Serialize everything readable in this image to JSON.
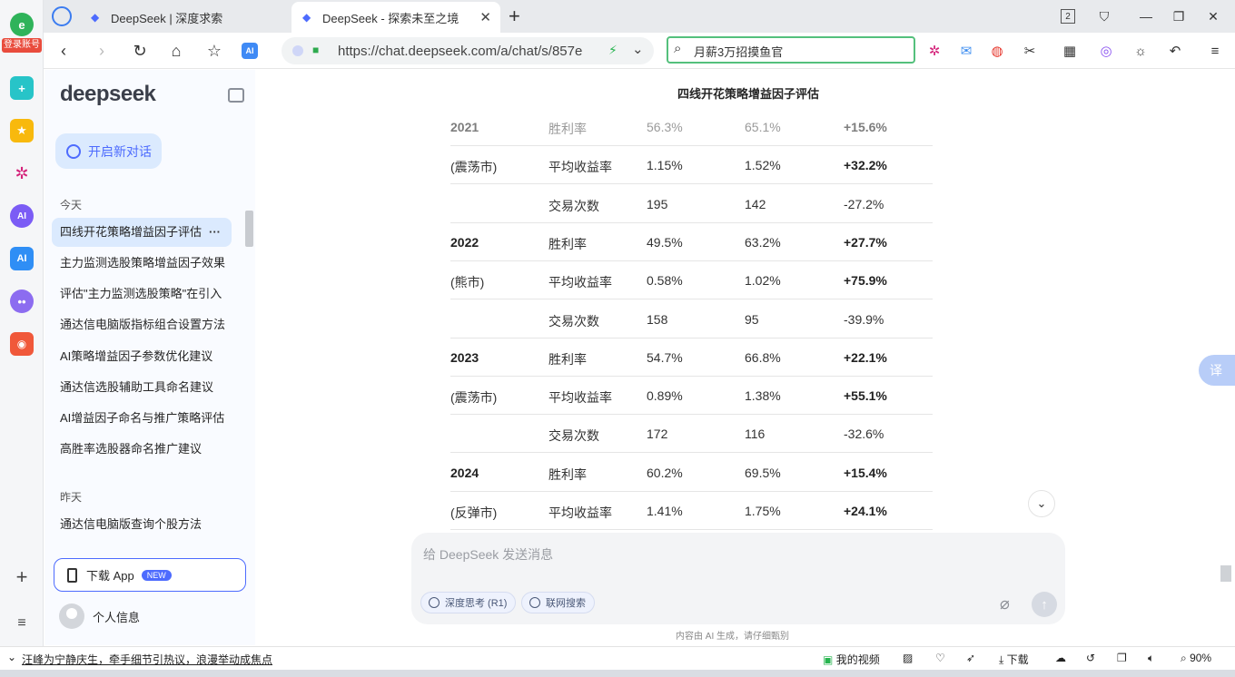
{
  "left_strip": {
    "login_label": "登录账号",
    "icons": [
      "browser-logo-icon",
      "plus-app-icon",
      "star-favorites-icon",
      "network-app-icon",
      "ai-assistant-icon",
      "ai-app-icon",
      "bot-icon",
      "game-icon",
      "add-icon",
      "menu-list-icon"
    ]
  },
  "tabs": [
    {
      "title": "DeepSeek | 深度求索",
      "active": false
    },
    {
      "title": "DeepSeek - 探索未至之境",
      "active": true
    }
  ],
  "tab_count": "2",
  "url": "https://chat.deepseek.com/a/chat/s/857e",
  "search_query": "月薪3万招摸鱼官",
  "sidebar": {
    "logo": "deepseek",
    "new_chat": "开启新对话",
    "today_label": "今天",
    "today_items": [
      "四线开花策略增益因子评估",
      "主力监测选股策略增益因子效果",
      "评估\"主力监测选股策略\"在引入",
      "通达信电脑版指标组合设置方法",
      "AI策略增益因子参数优化建议",
      "通达信选股辅助工具命名建议",
      "AI增益因子命名与推广策略评估",
      "高胜率选股器命名推广建议"
    ],
    "more_label": "···",
    "yesterday_label": "昨天",
    "yesterday_items": [
      "通达信电脑版查询个股方法"
    ],
    "download_app": "下载 App",
    "new_badge": "NEW",
    "profile": "个人信息"
  },
  "table": {
    "title": "四线开花策略增益因子评估",
    "rows": [
      {
        "year": "2021",
        "metric": "胜利率",
        "base": "56.3%",
        "gain": "65.1%",
        "change": "+15.6%",
        "change_bold": true,
        "faded": true
      },
      {
        "year": "(震荡市)",
        "metric": "平均收益率",
        "base": "1.15%",
        "gain": "1.52%",
        "change": "+32.2%",
        "change_bold": true
      },
      {
        "year": "",
        "metric": "交易次数",
        "base": "195",
        "gain": "142",
        "change": "-27.2%",
        "change_bold": false
      },
      {
        "year": "2022",
        "metric": "胜利率",
        "base": "49.5%",
        "gain": "63.2%",
        "change": "+27.7%",
        "change_bold": true,
        "year_bold": true
      },
      {
        "year": "(熊市)",
        "metric": "平均收益率",
        "base": "0.58%",
        "gain": "1.02%",
        "change": "+75.9%",
        "change_bold": true
      },
      {
        "year": "",
        "metric": "交易次数",
        "base": "158",
        "gain": "95",
        "change": "-39.9%",
        "change_bold": false
      },
      {
        "year": "2023",
        "metric": "胜利率",
        "base": "54.7%",
        "gain": "66.8%",
        "change": "+22.1%",
        "change_bold": true,
        "year_bold": true
      },
      {
        "year": "(震荡市)",
        "metric": "平均收益率",
        "base": "0.89%",
        "gain": "1.38%",
        "change": "+55.1%",
        "change_bold": true
      },
      {
        "year": "",
        "metric": "交易次数",
        "base": "172",
        "gain": "116",
        "change": "-32.6%",
        "change_bold": false
      },
      {
        "year": "2024",
        "metric": "胜利率",
        "base": "60.2%",
        "gain": "69.5%",
        "change": "+15.4%",
        "change_bold": true,
        "year_bold": true
      },
      {
        "year": "(反弹市)",
        "metric": "平均收益率",
        "base": "1.41%",
        "gain": "1.75%",
        "change": "+24.1%",
        "change_bold": true
      }
    ]
  },
  "translate_label": "译",
  "composer": {
    "placeholder": "给 DeepSeek 发送消息",
    "deep_think": "深度思考 (R1)",
    "web_search": "联网搜索"
  },
  "disclaimer": "内容由 AI 生成，请仔细甄别",
  "statusbar": {
    "news": "汪峰为宁静庆生，牵手细节引热议，浪漫举动成焦点",
    "my_video": "我的视频",
    "download": "下载",
    "zoom": "90%"
  }
}
